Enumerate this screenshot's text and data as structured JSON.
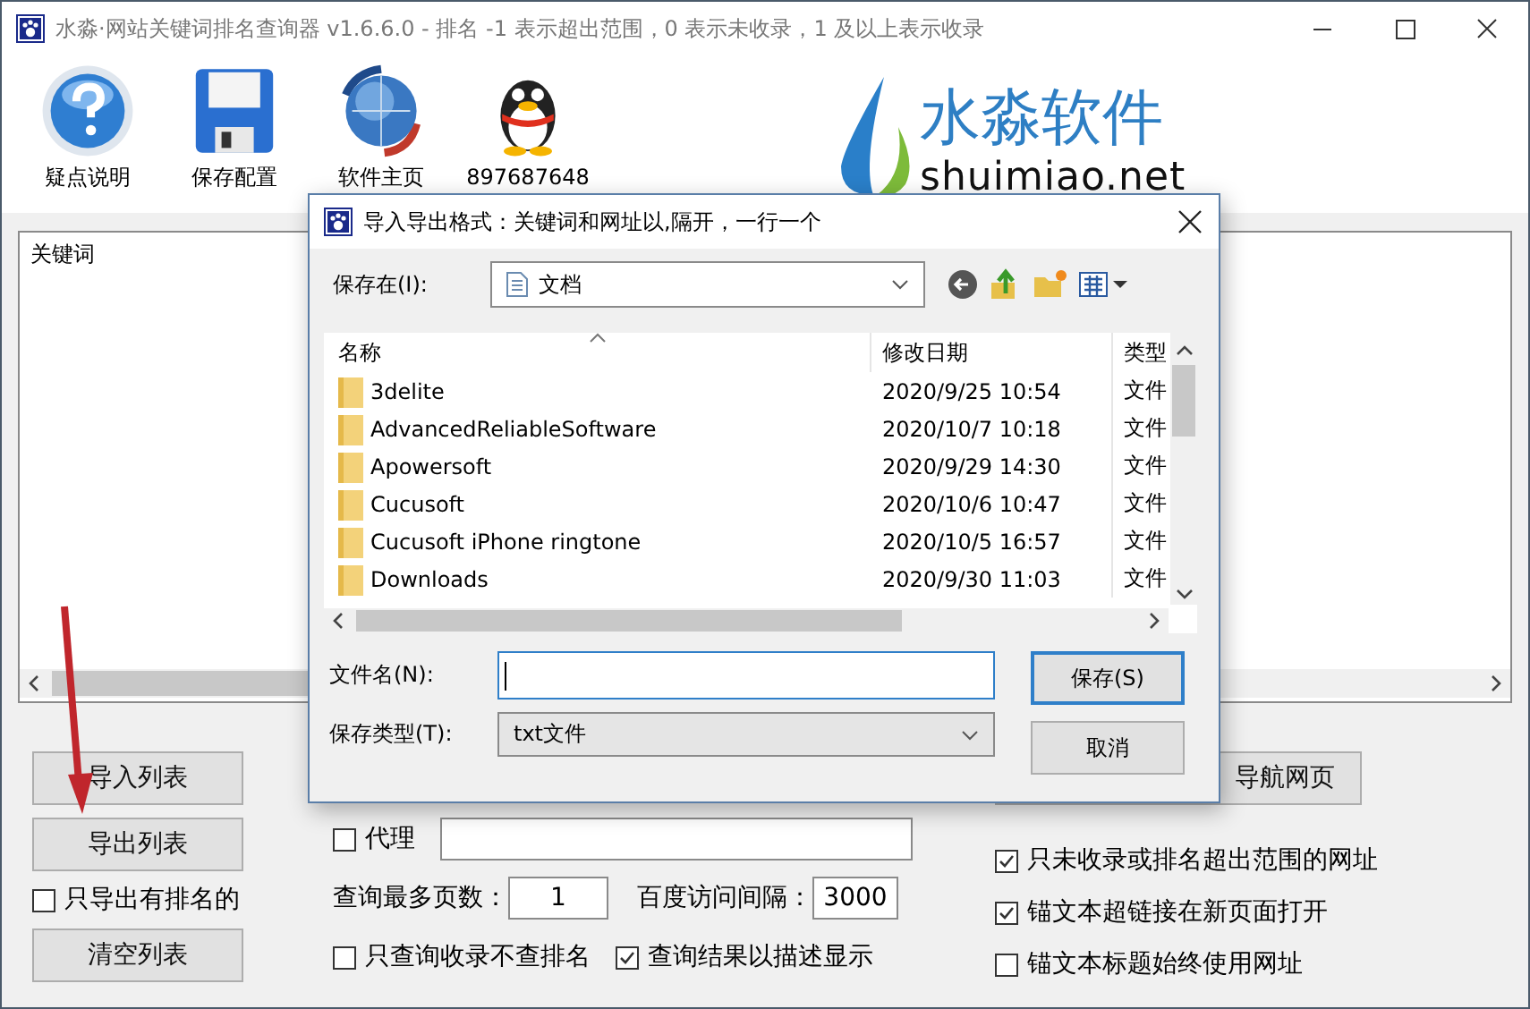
{
  "window": {
    "title": "水淼·网站关键词排名查询器 v1.6.6.0 - 排名 -1 表示超出范围，0 表示未收录，1 及以上表示收录"
  },
  "toolbar": [
    {
      "kind": "help",
      "label": "疑点说明"
    },
    {
      "kind": "save",
      "label": "保存配置"
    },
    {
      "kind": "globe",
      "label": "软件主页"
    },
    {
      "kind": "penguin",
      "label": "897687648"
    }
  ],
  "logo": {
    "brand": "水淼软件",
    "domain": "shuimiao.net"
  },
  "keyword_list": {
    "columns": [
      "关键词"
    ]
  },
  "left_panel": [
    {
      "kind": "button",
      "label": "导入列表"
    },
    {
      "kind": "button",
      "label": "导出列表"
    },
    {
      "kind": "checkbox",
      "label": "只导出有排名的",
      "checked": false
    },
    {
      "kind": "button",
      "label": "清空列表"
    }
  ],
  "middle_panel": {
    "proxy": {
      "label": "代理",
      "checked": false
    },
    "pages": {
      "label": "查询最多页数：",
      "value": "1"
    },
    "interval": {
      "label": "百度访问间隔：",
      "value": "3000"
    },
    "options": [
      {
        "label": "只查询收录不查排名",
        "checked": false
      },
      {
        "label": "查询结果以描述显示",
        "checked": true
      }
    ]
  },
  "right_panel": {
    "button": "导航网页",
    "options": [
      {
        "label": "只未收录或排名超出范围的网址",
        "checked": true
      },
      {
        "label": "锚文本超链接在新页面打开",
        "checked": true
      },
      {
        "label": "锚文本标题始终使用网址",
        "checked": false
      }
    ]
  },
  "dialog": {
    "title": "导入导出格式：关键词和网址以,隔开，一行一个",
    "save_in_label": "保存在(I):",
    "location": "文档",
    "columns": [
      "名称",
      "修改日期",
      "类型"
    ],
    "files": [
      {
        "name": "3delite",
        "modified": "2020/9/25 10:54",
        "type": "文件"
      },
      {
        "name": "AdvancedReliableSoftware",
        "modified": "2020/10/7 10:18",
        "type": "文件"
      },
      {
        "name": "Apowersoft",
        "modified": "2020/9/29 14:30",
        "type": "文件"
      },
      {
        "name": "Cucusoft",
        "modified": "2020/10/6 10:47",
        "type": "文件"
      },
      {
        "name": "Cucusoft iPhone ringtone",
        "modified": "2020/10/5 16:57",
        "type": "文件"
      },
      {
        "name": "Downloads",
        "modified": "2020/9/30 11:03",
        "type": "文件"
      }
    ],
    "filename_label": "文件名(N):",
    "filetype_label": "保存类型(T):",
    "filetype": "txt文件",
    "buttons": [
      "保存(S)",
      "取消"
    ]
  }
}
